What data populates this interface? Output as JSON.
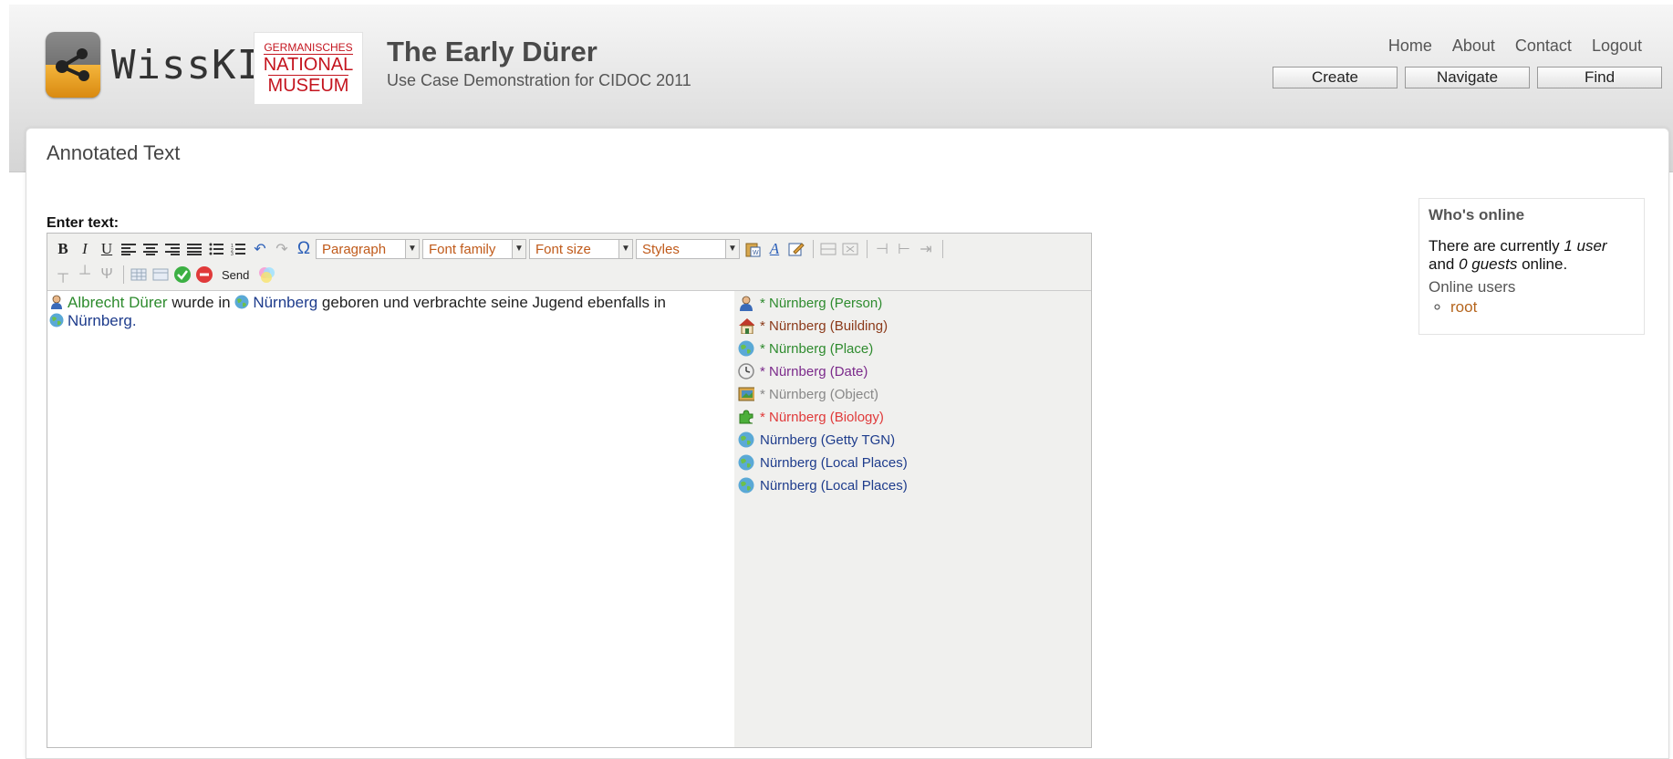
{
  "header": {
    "logo_text": "WissKI",
    "museum_logo": {
      "line1": "GERMANISCHES",
      "line2": "NATIONAL",
      "line3": "MUSEUM"
    },
    "site_title": "The Early Dürer",
    "site_slogan": "Use Case Demonstration for CIDOC 2011",
    "top_links": [
      "Home",
      "About",
      "Contact",
      "Logout"
    ],
    "main_buttons": [
      "Create",
      "Navigate",
      "Find"
    ]
  },
  "page": {
    "title": "Annotated Text",
    "enter_label": "Enter text:"
  },
  "editor": {
    "toolbar": {
      "selects": [
        {
          "label": "Paragraph"
        },
        {
          "label": "Font family"
        },
        {
          "label": "Font size"
        },
        {
          "label": "Styles"
        }
      ],
      "send_label": "Send"
    },
    "content": {
      "segments": [
        {
          "text": "Albrecht Dürer",
          "type": "person"
        },
        {
          "text": " wurde in ",
          "type": "plain"
        },
        {
          "text": "Nürnberg",
          "type": "place"
        },
        {
          "text": " geboren und verbrachte seine Jugend ebenfalls in ",
          "type": "plain"
        },
        {
          "text": "Nürnberg.",
          "type": "place"
        }
      ]
    },
    "suggestions": [
      {
        "label": "* Nürnberg (Person)",
        "icon": "person-icon",
        "color": "#2e8b2e"
      },
      {
        "label": "* Nürnberg (Building)",
        "icon": "house-icon",
        "color": "#8b3a1a"
      },
      {
        "label": "* Nürnberg (Place)",
        "icon": "globe-icon",
        "color": "#2e8b2e"
      },
      {
        "label": "* Nürnberg (Date)",
        "icon": "clock-icon",
        "color": "#7b2a8b"
      },
      {
        "label": "* Nürnberg (Object)",
        "icon": "picture-icon",
        "color": "#888888"
      },
      {
        "label": "* Nürnberg (Biology)",
        "icon": "puzzle-icon",
        "color": "#e03a3a"
      },
      {
        "label": "Nürnberg (Getty TGN)",
        "icon": "globe-icon",
        "color": "#1e3c8c"
      },
      {
        "label": "Nürnberg (Local Places)",
        "icon": "globe-icon",
        "color": "#1e3c8c"
      },
      {
        "label": "Nürnberg (Local Places)",
        "icon": "globe-icon",
        "color": "#1e3c8c"
      }
    ]
  },
  "whos_online": {
    "title": "Who's online",
    "text_before": "There are currently ",
    "users": "1 user",
    "text_middle": " and ",
    "guests": "0 guests",
    "text_after": " online.",
    "online_users_label": "Online users",
    "users_list": [
      "root"
    ]
  }
}
